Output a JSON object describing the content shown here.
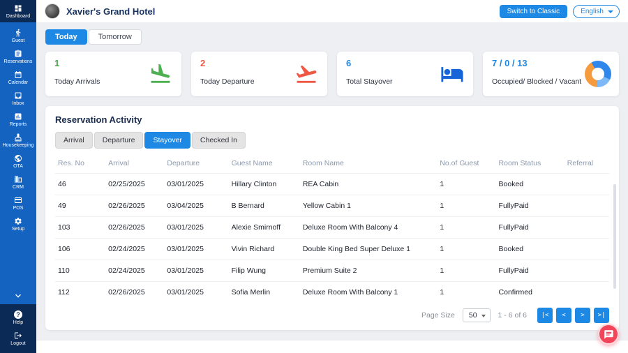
{
  "colors": {
    "primary": "#1e88e5",
    "sidebar": "#1563c1",
    "sidebar_dark": "#0c2a56",
    "green": "#43a047",
    "red": "#ef5844",
    "navy": "#16315f",
    "fab": "#f2455a"
  },
  "sidebar": {
    "items": [
      {
        "label": "Dashboard",
        "icon": "dashboard-icon"
      },
      {
        "label": "Guest",
        "icon": "guest-icon"
      },
      {
        "label": "Reservations",
        "icon": "reservations-icon"
      },
      {
        "label": "Calendar",
        "icon": "calendar-icon"
      },
      {
        "label": "Inbox",
        "icon": "inbox-icon"
      },
      {
        "label": "Reports",
        "icon": "reports-icon"
      },
      {
        "label": "Housekeeping",
        "icon": "housekeeping-icon"
      },
      {
        "label": "OTA",
        "icon": "ota-icon"
      },
      {
        "label": "CRM",
        "icon": "crm-icon"
      },
      {
        "label": "POS",
        "icon": "pos-icon"
      },
      {
        "label": "Setup",
        "icon": "setup-icon"
      }
    ],
    "footer": [
      {
        "label": "Help",
        "icon": "help-icon"
      },
      {
        "label": "Logout",
        "icon": "logout-icon"
      }
    ]
  },
  "header": {
    "title": "Xavier's Grand Hotel",
    "switch_to_classic": "Switch to Classic",
    "language": "English"
  },
  "day_tabs": [
    {
      "label": "Today",
      "active": true
    },
    {
      "label": "Tomorrow",
      "active": false
    }
  ],
  "stats": [
    {
      "value": "1",
      "label": "Today Arrivals",
      "color": "#43a047",
      "icon": "flight-land-icon"
    },
    {
      "value": "2",
      "label": "Today Departure",
      "color": "#ef5844",
      "icon": "flight-takeoff-icon"
    },
    {
      "value": "6",
      "label": "Total Stayover",
      "color": "#1e88e5",
      "icon": "bed-icon"
    },
    {
      "value": "7 / 0 / 13",
      "label": "Occupied/ Blocked / Vacant",
      "color": "#1e88e5",
      "icon": "donut-chart-icon"
    }
  ],
  "panel": {
    "title": "Reservation Activity",
    "tabs": [
      "Arrival",
      "Departure",
      "Stayover",
      "Checked In"
    ],
    "active_tab": "Stayover",
    "columns": [
      "Res. No",
      "Arrival",
      "Departure",
      "Guest Name",
      "Room Name",
      "No.of Guest",
      "Room Status",
      "Referral"
    ],
    "rows": [
      [
        "46",
        "02/25/2025",
        "03/01/2025",
        "Hillary Clinton",
        "REA Cabin",
        "1",
        "Booked",
        ""
      ],
      [
        "49",
        "02/26/2025",
        "03/04/2025",
        "B Bernard",
        "Yellow Cabin 1",
        "1",
        "FullyPaid",
        ""
      ],
      [
        "103",
        "02/26/2025",
        "03/01/2025",
        "Alexie Smirnoff",
        "Deluxe Room With Balcony 4",
        "1",
        "FullyPaid",
        ""
      ],
      [
        "106",
        "02/24/2025",
        "03/01/2025",
        "Vivin Richard",
        "Double King Bed Super Deluxe 1",
        "1",
        "Booked",
        ""
      ],
      [
        "110",
        "02/24/2025",
        "03/01/2025",
        "Filip Wung",
        "Premium Suite 2",
        "1",
        "FullyPaid",
        ""
      ],
      [
        "112",
        "02/26/2025",
        "03/01/2025",
        "Sofia Merlin",
        "Deluxe Room With Balcony 1",
        "1",
        "Confirmed",
        ""
      ]
    ],
    "pagination": {
      "label": "Page Size",
      "size": "50",
      "range": "1 - 6 of 6",
      "icons": [
        "|<",
        "<",
        ">",
        ">|"
      ]
    }
  },
  "icons": {
    "help_glyph": "?"
  }
}
